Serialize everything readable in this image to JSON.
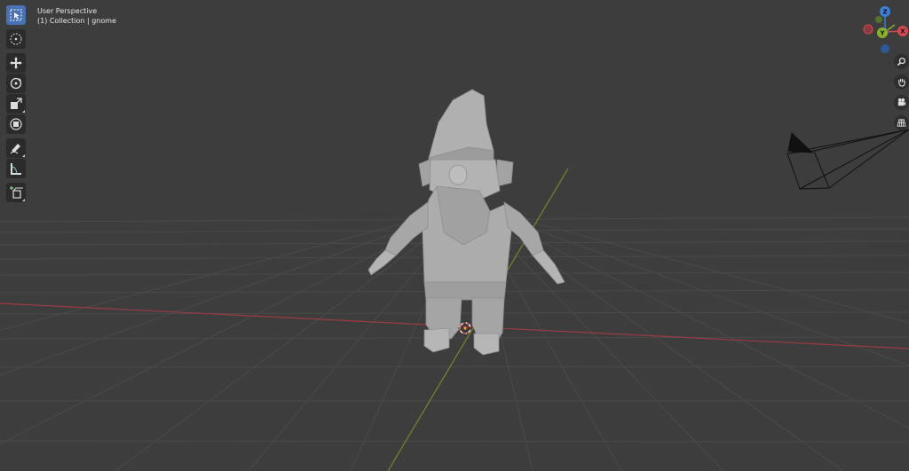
{
  "viewport": {
    "view_name": "User Perspective",
    "collection_info": "(1) Collection | gnome"
  },
  "gizmo": {
    "z_label": "Z",
    "x_label": "X",
    "y_label": "Y",
    "colors": {
      "x": "#d5484f",
      "y": "#88b02d",
      "z": "#3b7fd6"
    }
  },
  "toolbar": {
    "tools": [
      {
        "name": "select-box",
        "icon": "cursor-arrow-icon",
        "active": true
      },
      {
        "name": "cursor",
        "icon": "3d-cursor-icon",
        "active": false
      },
      {
        "name": "move",
        "icon": "move-arrows-icon",
        "active": false
      },
      {
        "name": "rotate",
        "icon": "rotate-icon",
        "active": false
      },
      {
        "name": "scale",
        "icon": "scale-icon",
        "active": false
      },
      {
        "name": "transform",
        "icon": "transform-icon",
        "active": false
      },
      {
        "name": "annotate",
        "icon": "annotate-pencil-icon",
        "active": false
      },
      {
        "name": "measure",
        "icon": "measure-ruler-icon",
        "active": false
      },
      {
        "name": "add-cube",
        "icon": "add-cube-icon",
        "active": false
      }
    ]
  },
  "nav": {
    "buttons": [
      "zoom-magnifier-icon",
      "pan-hand-icon",
      "camera-view-icon",
      "perspective-grid-icon"
    ]
  },
  "colors": {
    "background": "#3d3d3d",
    "grid": "#4a4a4a",
    "x_axis": "#9a3b45",
    "y_axis": "#6f8a2a",
    "active_tool": "#4872b4",
    "model": "#a8a8a8"
  }
}
